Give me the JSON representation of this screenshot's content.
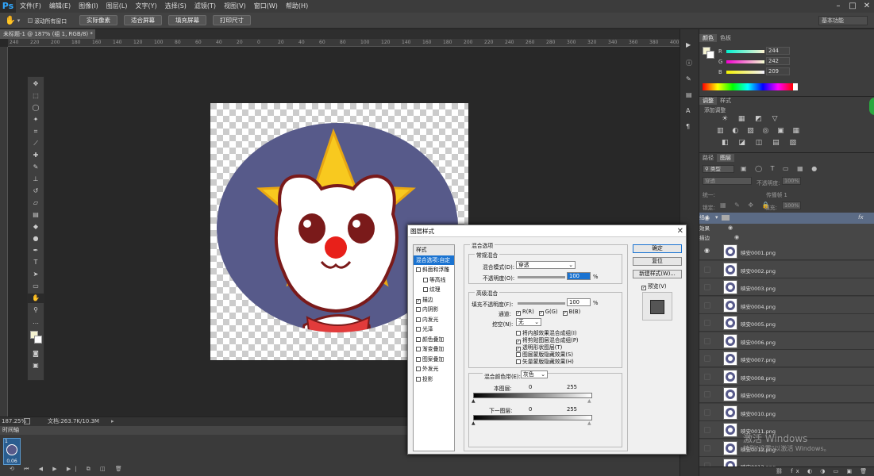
{
  "app": {
    "logo": "Ps",
    "menu": [
      "文件(F)",
      "编辑(E)",
      "图像(I)",
      "图层(L)",
      "文字(Y)",
      "选择(S)",
      "滤镜(T)",
      "视图(V)",
      "窗口(W)",
      "帮助(H)"
    ],
    "window_controls": [
      "–",
      "□",
      "✕"
    ]
  },
  "options_bar": {
    "scroll_all_label": "滚动所有窗口",
    "buttons": [
      "实际像素",
      "适合屏幕",
      "填充屏幕",
      "打印尺寸"
    ],
    "workspace": "基本功能"
  },
  "document": {
    "tab_title": "未标题-1 @ 187% (组 1, RGB/8) *",
    "zoom": "187.25%",
    "doc_info": "文档:263.7K/10.3M",
    "ruler_ticks": [
      "240",
      "220",
      "200",
      "180",
      "160",
      "140",
      "120",
      "100",
      "80",
      "60",
      "40",
      "20",
      "0",
      "20",
      "40",
      "60",
      "80",
      "100",
      "120",
      "140",
      "160",
      "180",
      "200",
      "220",
      "240",
      "260",
      "280",
      "300",
      "320",
      "340",
      "360",
      "380",
      "400"
    ]
  },
  "timeline": {
    "title": "时间轴",
    "frame_number": "1",
    "frame_delay": "0.06"
  },
  "color_panel": {
    "tabs": [
      "颜色",
      "色板"
    ],
    "channels": [
      {
        "label": "R",
        "value": "244"
      },
      {
        "label": "G",
        "value": "242"
      },
      {
        "label": "B",
        "value": "209"
      }
    ]
  },
  "adjust_panel": {
    "tabs": [
      "调整",
      "样式"
    ],
    "hint": "添加调整"
  },
  "layers_panel": {
    "tabs": [
      "路径",
      "图层"
    ],
    "kind_label": "类型",
    "blend": "穿透",
    "opacity_label": "不透明度:",
    "opacity": "100%",
    "lock_label": "锁定:",
    "fill_label": "填充:",
    "fill": "100%",
    "propagate_label": "统一:",
    "propagate_frame": "传播帧 1",
    "group_name": "组 1",
    "effects_label": "效果",
    "stroke_label": "描边",
    "fx": "fx",
    "layers": [
      "映安0001.png",
      "映安0002.png",
      "映安0003.png",
      "映安0004.png",
      "映安0005.png",
      "映安0006.png",
      "映安0007.png",
      "映安0008.png",
      "映安0009.png",
      "映安0010.png",
      "映安0011.png",
      "映安0012.png",
      "映安0013.png"
    ]
  },
  "dialog": {
    "title": "图层样式",
    "close": "✕",
    "styles_header": "样式",
    "styles": [
      {
        "label": "混合选项:自定",
        "checked": null,
        "active": true,
        "indent": false
      },
      {
        "label": "斜面和浮雕",
        "checked": false,
        "active": false,
        "indent": false
      },
      {
        "label": "等高线",
        "checked": false,
        "active": false,
        "indent": true
      },
      {
        "label": "纹理",
        "checked": false,
        "active": false,
        "indent": true
      },
      {
        "label": "描边",
        "checked": true,
        "active": false,
        "indent": false
      },
      {
        "label": "内阴影",
        "checked": false,
        "active": false,
        "indent": false
      },
      {
        "label": "内发光",
        "checked": false,
        "active": false,
        "indent": false
      },
      {
        "label": "光泽",
        "checked": false,
        "active": false,
        "indent": false
      },
      {
        "label": "颜色叠加",
        "checked": false,
        "active": false,
        "indent": false
      },
      {
        "label": "渐变叠加",
        "checked": false,
        "active": false,
        "indent": false
      },
      {
        "label": "图案叠加",
        "checked": false,
        "active": false,
        "indent": false
      },
      {
        "label": "外发光",
        "checked": false,
        "active": false,
        "indent": false
      },
      {
        "label": "投影",
        "checked": false,
        "active": false,
        "indent": false
      }
    ],
    "blend_options_title": "混合选项",
    "general_title": "常规混合",
    "blend_mode_label": "混合模式(D):",
    "blend_mode": "穿透",
    "opacity_label": "不透明度(O):",
    "opacity_value": "100",
    "percent": "%",
    "advanced_title": "高级混合",
    "fill_opacity_label": "填充不透明度(F):",
    "fill_opacity_value": "100",
    "channels_label": "通道:",
    "channels": [
      "R(R)",
      "G(G)",
      "B(B)"
    ],
    "knockout_label": "挖空(N):",
    "knockout_value": "无",
    "adv_checks": [
      {
        "label": "将内部效果混合成组(I)",
        "checked": false
      },
      {
        "label": "将剪贴图层混合成组(P)",
        "checked": true
      },
      {
        "label": "透明形状图层(T)",
        "checked": true
      },
      {
        "label": "图层蒙版隐藏效果(S)",
        "checked": false
      },
      {
        "label": "矢量蒙版隐藏效果(H)",
        "checked": false
      }
    ],
    "blend_if_label": "混合颜色带(E):",
    "blend_if_value": "灰色",
    "this_layer_label": "本图层:",
    "underlying_label": "下一图层:",
    "range_min": "0",
    "range_max": "255",
    "ok": "确定",
    "reset": "复位",
    "new_style": "新建样式(W)...",
    "preview": "预览(V)"
  },
  "watermark": {
    "line1": "激活 Windows",
    "line2": "转到\"设置\"以激活 Windows。"
  },
  "colors": {
    "accent": "#1a73d1",
    "bg_dark": "#282828",
    "panel": "#3d3d3d",
    "fg_swatch": "#f4f2d1",
    "art_blue": "#575a8a",
    "art_yellow": "#f8c91f",
    "art_red": "#e8201a"
  }
}
